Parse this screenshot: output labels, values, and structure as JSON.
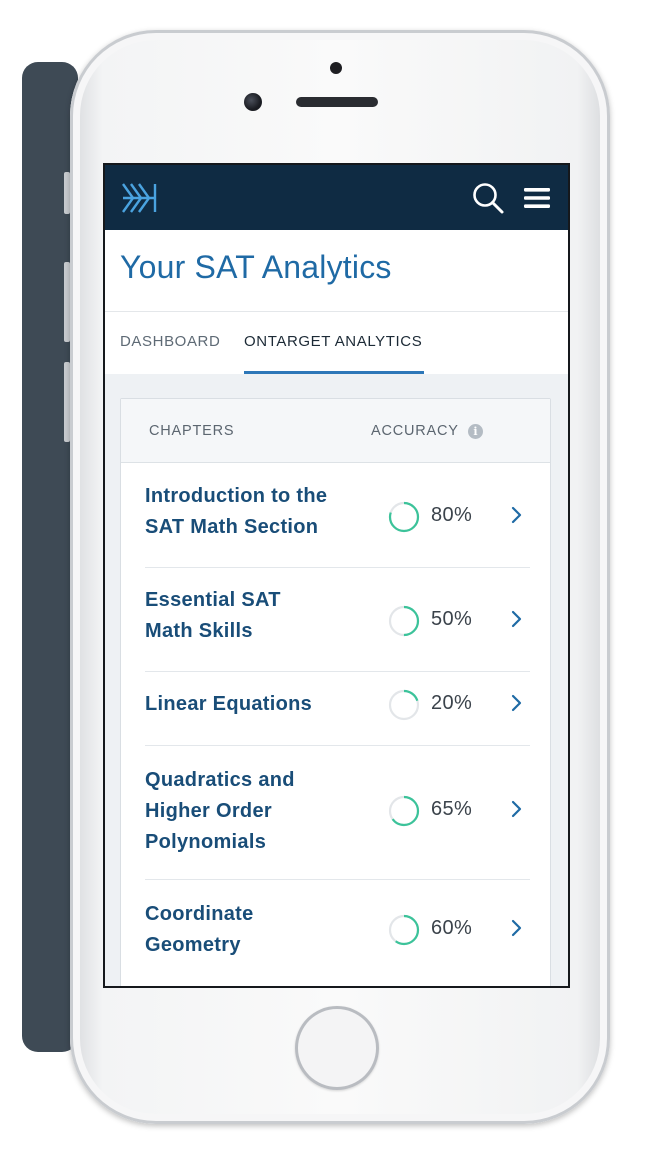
{
  "app": {
    "page_title": "Your SAT Analytics",
    "logo_icon": "kaplan-arrow-logo-icon",
    "accent_color": "#1f6aa5",
    "ring_color": "#3cc39a",
    "topbar_color": "#0f2b43"
  },
  "tabs": [
    {
      "label": "DASHBOARD",
      "active": false
    },
    {
      "label": "ONTARGET ANALYTICS",
      "active": true
    }
  ],
  "table": {
    "headers": {
      "chapters": "CHAPTERS",
      "accuracy": "ACCURACY",
      "info_icon": "i"
    },
    "rows": [
      {
        "title": [
          "Introduction to the",
          "SAT Math Section"
        ],
        "accuracy": "80%",
        "value": 0.8
      },
      {
        "title": [
          "Essential SAT",
          "Math Skills"
        ],
        "accuracy": "50%",
        "value": 0.5
      },
      {
        "title": [
          "Linear Equations"
        ],
        "accuracy": "20%",
        "value": 0.2
      },
      {
        "title": [
          "Quadratics and",
          "Higher Order",
          "Polynomials"
        ],
        "accuracy": "65%",
        "value": 0.65
      },
      {
        "title": [
          "Coordinate",
          "Geometry"
        ],
        "accuracy": "60%",
        "value": 0.6
      }
    ]
  }
}
